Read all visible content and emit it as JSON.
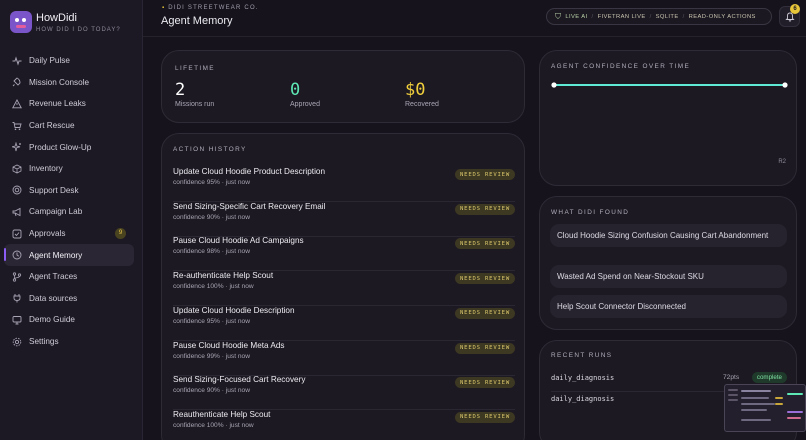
{
  "app": {
    "name": "HowDidi",
    "tagline": "HOW DID I DO TODAY?"
  },
  "sidebar": {
    "items": [
      {
        "label": "Daily Pulse",
        "icon": "pulse-icon"
      },
      {
        "label": "Mission Console",
        "icon": "rocket-icon"
      },
      {
        "label": "Revenue Leaks",
        "icon": "warning-icon"
      },
      {
        "label": "Cart Rescue",
        "icon": "cart-icon"
      },
      {
        "label": "Product Glow-Up",
        "icon": "sparkle-icon"
      },
      {
        "label": "Inventory",
        "icon": "box-icon"
      },
      {
        "label": "Support Desk",
        "icon": "lifebuoy-icon"
      },
      {
        "label": "Campaign Lab",
        "icon": "megaphone-icon"
      },
      {
        "label": "Approvals",
        "icon": "check-icon",
        "badge": "9"
      },
      {
        "label": "Agent Memory",
        "icon": "history-icon",
        "active": true
      },
      {
        "label": "Agent Traces",
        "icon": "branch-icon"
      },
      {
        "label": "Data sources",
        "icon": "plug-icon"
      },
      {
        "label": "Demo Guide",
        "icon": "monitor-icon"
      },
      {
        "label": "Settings",
        "icon": "gear-icon"
      }
    ]
  },
  "header": {
    "company": "DIDI STREETWEAR CO.",
    "title": "Agent Memory",
    "status": [
      "LIVE AI",
      "FIVETRAN LIVE",
      "SQLITE",
      "READ-ONLY ACTIONS"
    ],
    "notification_count": "6"
  },
  "lifetime": {
    "label": "LIFETIME",
    "stats": [
      {
        "value": "2",
        "label": "Missions run",
        "color": "#ffffff"
      },
      {
        "value": "0",
        "label": "Approved",
        "color": "#5ee8b5"
      },
      {
        "value": "$0",
        "label": "Recovered",
        "color": "#f1cf3c"
      }
    ]
  },
  "history": {
    "label": "ACTION HISTORY",
    "badge_label": "NEEDS REVIEW",
    "rows": [
      {
        "title": "Update Cloud Hoodie Product Description",
        "sub": "confidence 95% · just now"
      },
      {
        "title": "Send Sizing-Specific Cart Recovery Email",
        "sub": "confidence 90% · just now"
      },
      {
        "title": "Pause Cloud Hoodie Ad Campaigns",
        "sub": "confidence 98% · just now"
      },
      {
        "title": "Re-authenticate Help Scout",
        "sub": "confidence 100% · just now"
      },
      {
        "title": "Update Cloud Hoodie Description",
        "sub": "confidence 95% · just now"
      },
      {
        "title": "Pause Cloud Hoodie Meta Ads",
        "sub": "confidence 99% · just now"
      },
      {
        "title": "Send Sizing-Focused Cart Recovery",
        "sub": "confidence 90% · just now"
      },
      {
        "title": "Reauthenticate Help Scout",
        "sub": "confidence 100% · just now"
      }
    ]
  },
  "confidence": {
    "label": "AGENT CONFIDENCE OVER TIME",
    "end_label": "R2",
    "line_color": "#5eead4"
  },
  "found": {
    "label": "WHAT DIDI FOUND",
    "items": [
      "Cloud Hoodie Sizing Confusion Causing Cart Abandonment",
      "Wasted Ad Spend on Near-Stockout SKU",
      "Help Scout Connector Disconnected"
    ]
  },
  "runs": {
    "label": "RECENT RUNS",
    "rows": [
      {
        "name": "daily_diagnosis",
        "pts": "72pts",
        "status": "complete"
      },
      {
        "name": "daily_diagnosis",
        "pts": "",
        "status": ""
      }
    ]
  }
}
